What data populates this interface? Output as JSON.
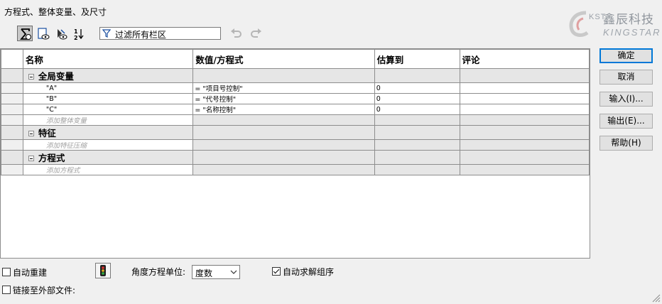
{
  "window": {
    "title": "方程式、整体变量、及尺寸"
  },
  "logo": {
    "prefix": "KST",
    "name_cn": "鑫辰科技",
    "name_en": "KINGSTAR"
  },
  "toolbar": {
    "filter_placeholder": "过滤所有栏区",
    "buttons": [
      "sigma-view",
      "sheet-view",
      "dependency-view",
      "ordered-view"
    ]
  },
  "grid": {
    "columns": [
      "名称",
      "数值/方程式",
      "估算到",
      "评论"
    ],
    "groups": [
      {
        "name": "全局变量",
        "rows": [
          {
            "name": "\"A\"",
            "value": "= \"项目号控制\"",
            "evaluates": "0",
            "comment": ""
          },
          {
            "name": "\"B\"",
            "value": "= \"代号控制\"",
            "evaluates": "0",
            "comment": ""
          },
          {
            "name": "\"C\"",
            "value": "= \"名称控制\"",
            "evaluates": "0",
            "comment": ""
          }
        ],
        "add_label": "添加整体变量"
      },
      {
        "name": "特征",
        "rows": [],
        "add_label": "添加特征压缩"
      },
      {
        "name": "方程式",
        "rows": [],
        "add_label": "添加方程式"
      }
    ]
  },
  "buttons": {
    "ok": "确定",
    "cancel": "取消",
    "import": "输入(I)...",
    "export": "输出(E)...",
    "help": "帮助(H)"
  },
  "options": {
    "auto_rebuild": "自动重建",
    "auto_rebuild_checked": false,
    "angle_unit_label": "角度方程单位:",
    "angle_unit_value": "度数",
    "auto_solve": "自动求解组序",
    "auto_solve_checked": true,
    "link_external": "链接至外部文件:",
    "link_external_checked": false
  }
}
